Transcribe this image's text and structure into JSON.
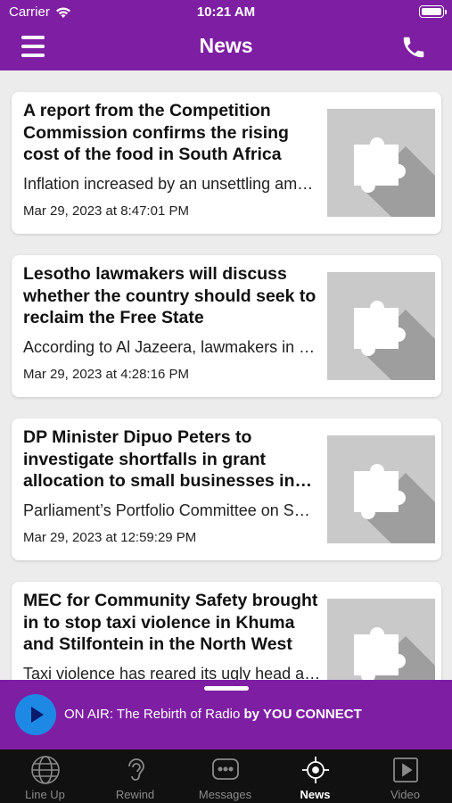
{
  "status_bar": {
    "carrier": "Carrier",
    "time": "10:21 AM"
  },
  "nav": {
    "title": "News"
  },
  "articles": [
    {
      "title": "A report from the Competition Commission confirms the rising cost of the food in South Africa",
      "summary": "Inflation increased by an unsettling amount",
      "date": "Mar 29, 2023 at 8:47:01 PM"
    },
    {
      "title": "Lesotho lawmakers will discuss whether the country should seek to reclaim the Free State",
      "summary": "According to Al Jazeera, lawmakers in Lesotho",
      "date": "Mar 29, 2023 at 4:28:16 PM"
    },
    {
      "title": "DP Minister Dipuo Peters to investigate shortfalls in grant allocation to small businesses in the province",
      "summary": "Parliament’s Portfolio Committee on Small Business",
      "date": "Mar 29, 2023 at 12:59:29 PM"
    },
    {
      "title": "MEC for Community Safety brought in to stop taxi violence in Khuma and Stilfontein in the North West",
      "summary": "Taxi violence has reared its ugly head again",
      "date": ""
    }
  ],
  "player": {
    "on_air_prefix": "ON AIR: The Rebirth of Radio",
    "by_label": "by YOU CONNECT"
  },
  "tabs": [
    {
      "label": "Line Up",
      "icon": "globe-icon"
    },
    {
      "label": "Rewind",
      "icon": "ear-icon"
    },
    {
      "label": "Messages",
      "icon": "chat-bubble-icon"
    },
    {
      "label": "News",
      "icon": "news-compass-icon",
      "active": true
    },
    {
      "label": "Video",
      "icon": "video-play-icon"
    }
  ],
  "colors": {
    "brand": "#7e1fa3",
    "play_button": "#1e88e5",
    "tabbar": "#111111"
  }
}
